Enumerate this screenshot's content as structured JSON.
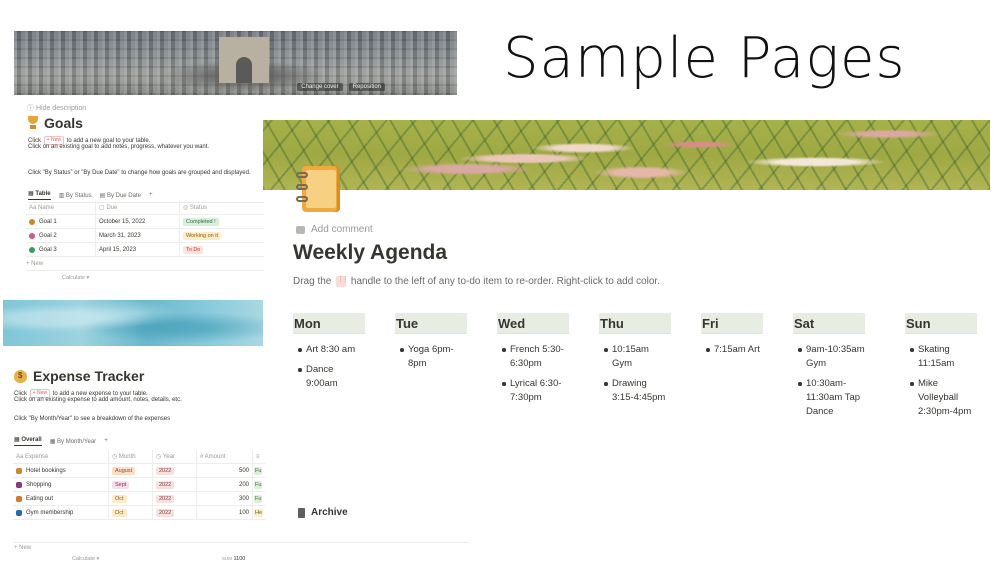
{
  "heading": "Sample Pages",
  "paris_banner": {
    "buttons": [
      "Change cover",
      "Reposition"
    ]
  },
  "goals": {
    "hide_description": "Hide description",
    "title": "Goals",
    "desc_line1_a": "Click",
    "new_chip": "+ New",
    "desc_line1_b": "to add a new goal to your table.",
    "desc_line2": "Click on an existing goal to add notes, progress, whatever you want.",
    "desc_line3": "Click \"By Status\" or \"By Due Date\" to change how goals are grouped and displayed.",
    "views": [
      "Table",
      "By Status",
      "By Due Date",
      "+"
    ],
    "columns": [
      "Aa Name",
      "Due",
      "Status"
    ],
    "rows": [
      {
        "name": "Goal 1",
        "due": "October 15, 2022",
        "status": "Completed !",
        "status_bg": "#dbeddb",
        "status_fg": "#2b6e3a",
        "icon_color": "#c98a2e"
      },
      {
        "name": "Goal 2",
        "due": "March 31, 2023",
        "status": "Working on it",
        "status_bg": "#fdecc8",
        "status_fg": "#8a5a12",
        "icon_color": "#d05a7a"
      },
      {
        "name": "Goal 3",
        "due": "April 15, 2023",
        "status": "To Do",
        "status_bg": "#ffe2dd",
        "status_fg": "#b1432f",
        "icon_color": "#3c9a5f"
      }
    ],
    "new_row": "+ New",
    "calculate": "Calculate ▾"
  },
  "expense": {
    "title": "Expense Tracker",
    "desc_line1_a": "Click",
    "new_chip": "+ New",
    "desc_line1_b": "to add a new expense to your table.",
    "desc_line2": "Click on an existing expense to add amount, notes, details, etc.",
    "desc_line3": "Click \"By Month/Year\" to see a breakdown of the expenses",
    "views": [
      "Overall",
      "By Month/Year",
      "+"
    ],
    "columns": [
      "Aa Expense",
      "Month",
      "Year",
      "# Amount",
      "≡"
    ],
    "rows": [
      {
        "name": "Hotel bookings",
        "month": "August",
        "year": "2022",
        "amount": "500",
        "extra": "Fu",
        "icon_color": "#c98a2e"
      },
      {
        "name": "Shopping",
        "month": "Sept",
        "year": "2022",
        "amount": "200",
        "extra": "Fu",
        "icon_color": "#8a3a7a"
      },
      {
        "name": "Eating out",
        "month": "Oct",
        "year": "2022",
        "amount": "300",
        "extra": "Fu",
        "icon_color": "#d07a2a"
      },
      {
        "name": "Gym membership",
        "month": "Oct",
        "year": "2022",
        "amount": "100",
        "extra": "He",
        "icon_color": "#2a6ab0"
      }
    ],
    "new_row": "+ New",
    "calculate": "Calculate ▾",
    "sum_label": "SUM",
    "sum_value": "1100"
  },
  "agenda": {
    "add_comment": "Add comment",
    "title": "Weekly Agenda",
    "subtitle_a": "Drag the",
    "subtitle_b": "handle to the left of any to-do item to re-order. Right-click to add color.",
    "days": [
      {
        "name": "Mon",
        "items": [
          "Art 8:30 am",
          "Dance 9:00am"
        ]
      },
      {
        "name": "Tue",
        "items": [
          "Yoga 6pm-8pm"
        ]
      },
      {
        "name": "Wed",
        "items": [
          "French 5:30-6:30pm",
          "Lyrical 6:30-7:30pm"
        ]
      },
      {
        "name": "Thu",
        "items": [
          "10:15am Gym",
          "Drawing 3:15-4:45pm"
        ]
      },
      {
        "name": "Fri",
        "items": [
          "7:15am Art"
        ]
      },
      {
        "name": "Sat",
        "items": [
          "9am-10:35am Gym",
          "10:30am-11:30am Tap Dance"
        ]
      },
      {
        "name": "Sun",
        "items": [
          "Skating 11:15am",
          "Mike Volleyball 2:30pm-4pm"
        ]
      }
    ],
    "archive": "Archive"
  }
}
